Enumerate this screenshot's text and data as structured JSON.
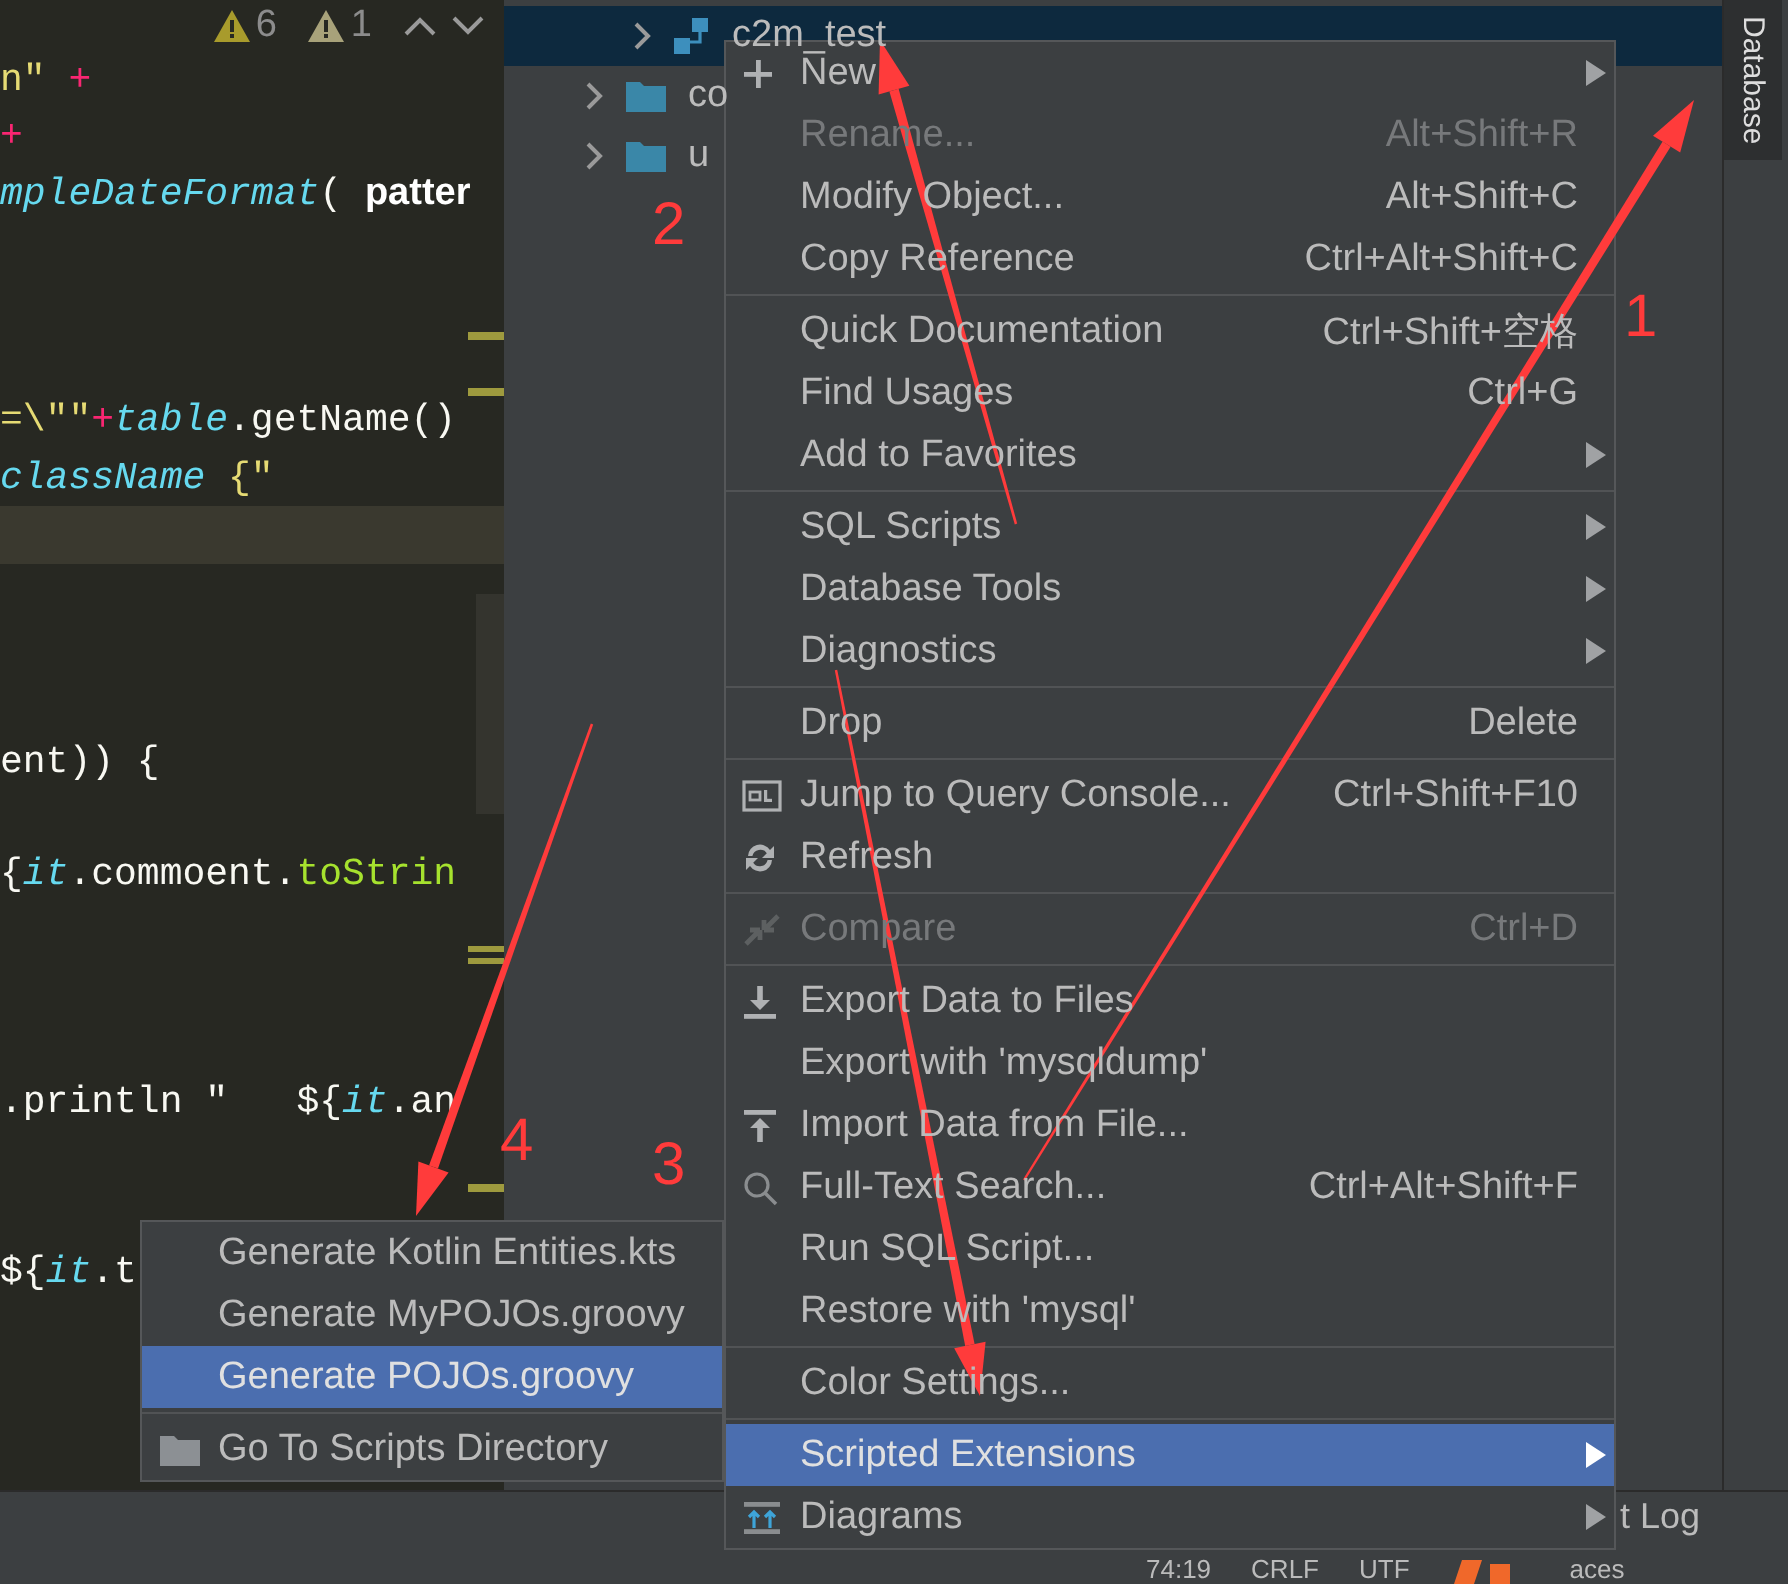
{
  "editor": {
    "warnings": [
      {
        "kind": "warning",
        "count": "6"
      },
      {
        "kind": "weak_warning",
        "count": "1"
      }
    ],
    "lines": [
      {
        "kind": "code",
        "segments": [
          {
            "kind": "string",
            "t": "n\""
          },
          {
            "kind": "op",
            "t": " +"
          }
        ]
      },
      {
        "kind": "code",
        "segments": [
          {
            "kind": "op",
            "t": "+"
          }
        ]
      },
      {
        "kind": "code",
        "segments": [
          {
            "kind": "type",
            "t": "mpleDateFormat"
          },
          {
            "kind": "plain",
            "t": "( "
          },
          {
            "kind": "hint",
            "t": "patter"
          }
        ]
      },
      {
        "kind": "blank"
      },
      {
        "kind": "marked"
      },
      {
        "kind": "marked"
      },
      {
        "kind": "code",
        "segments": [
          {
            "kind": "string",
            "t": "=\\\"\""
          },
          {
            "kind": "op",
            "t": "+"
          },
          {
            "kind": "type",
            "t": "table"
          },
          {
            "kind": "plain",
            "t": ".getName()"
          }
        ]
      },
      {
        "kind": "code",
        "segments": [
          {
            "kind": "type",
            "t": "className"
          },
          {
            "kind": "string",
            "t": " {\""
          }
        ]
      },
      {
        "kind": "current"
      },
      {
        "kind": "blank"
      },
      {
        "kind": "blank"
      },
      {
        "kind": "blank"
      },
      {
        "kind": "code",
        "segments": [
          {
            "kind": "plain",
            "t": "ent)) {"
          }
        ]
      },
      {
        "kind": "blank"
      },
      {
        "kind": "code",
        "segments": [
          {
            "kind": "plain",
            "t": "{"
          },
          {
            "kind": "type",
            "t": "it"
          },
          {
            "kind": "plain",
            "t": ".commoent."
          },
          {
            "kind": "method",
            "t": "toStrin"
          }
        ]
      },
      {
        "kind": "double_marked"
      },
      {
        "kind": "blank"
      },
      {
        "kind": "blank"
      },
      {
        "kind": "code",
        "segments": [
          {
            "kind": "plain",
            "t": ".println \"   ${"
          },
          {
            "kind": "type",
            "t": "it"
          },
          {
            "kind": "plain",
            "t": ".an"
          }
        ]
      },
      {
        "kind": "marked"
      },
      {
        "kind": "blank"
      },
      {
        "kind": "code",
        "segments": [
          {
            "kind": "plain",
            "t": "${"
          },
          {
            "kind": "type",
            "t": "it"
          },
          {
            "kind": "plain",
            "t": ".t"
          }
        ]
      }
    ]
  },
  "tree": {
    "rows": [
      {
        "label": "c2m_test",
        "kind": "schema",
        "selected": true
      },
      {
        "label": "co",
        "kind": "folder",
        "selected": false
      },
      {
        "label": "u",
        "kind": "folder",
        "selected": false
      }
    ]
  },
  "side_tabs": [
    {
      "label": "Database",
      "selected": true
    }
  ],
  "context_menu": {
    "groups": [
      {
        "items": [
          {
            "label": "New",
            "kind": "plus",
            "submenu": true,
            "disabled": false,
            "selected": false
          },
          {
            "label": "Rename...",
            "shortcut": "Alt+Shift+R",
            "disabled": true,
            "selected": false
          },
          {
            "label": "Modify Object...",
            "shortcut": "Alt+Shift+C",
            "disabled": false,
            "selected": false
          },
          {
            "label": "Copy Reference",
            "shortcut": "Ctrl+Alt+Shift+C",
            "disabled": false,
            "selected": false
          }
        ]
      },
      {
        "items": [
          {
            "label": "Quick Documentation",
            "shortcut": "Ctrl+Shift+空格",
            "disabled": false,
            "selected": false
          },
          {
            "label": "Find Usages",
            "shortcut": "Ctrl+G",
            "disabled": false,
            "selected": false
          },
          {
            "label": "Add to Favorites",
            "submenu": true,
            "disabled": false,
            "selected": false
          }
        ]
      },
      {
        "items": [
          {
            "label": "SQL Scripts",
            "submenu": true,
            "disabled": false,
            "selected": false
          },
          {
            "label": "Database Tools",
            "submenu": true,
            "disabled": false,
            "selected": false
          },
          {
            "label": "Diagnostics",
            "submenu": true,
            "disabled": false,
            "selected": false
          }
        ]
      },
      {
        "items": [
          {
            "label": "Drop",
            "shortcut": "Delete",
            "disabled": false,
            "selected": false
          }
        ]
      },
      {
        "items": [
          {
            "label": "Jump to Query Console...",
            "kind": "console",
            "shortcut": "Ctrl+Shift+F10",
            "disabled": false,
            "selected": false
          },
          {
            "label": "Refresh",
            "kind": "refresh",
            "disabled": false,
            "selected": false
          }
        ]
      },
      {
        "items": [
          {
            "label": "Compare",
            "kind": "compare",
            "shortcut": "Ctrl+D",
            "disabled": true,
            "selected": false
          }
        ]
      },
      {
        "items": [
          {
            "label": "Export Data to Files",
            "kind": "download",
            "disabled": false,
            "selected": false
          },
          {
            "label": "Export with 'mysqldump'",
            "disabled": false,
            "selected": false
          },
          {
            "label": "Import Data from File...",
            "kind": "upload",
            "disabled": false,
            "selected": false
          },
          {
            "label": "Full-Text Search...",
            "kind": "search",
            "shortcut": "Ctrl+Alt+Shift+F",
            "disabled": false,
            "selected": false
          },
          {
            "label": "Run SQL Script...",
            "disabled": false,
            "selected": false
          },
          {
            "label": "Restore with 'mysql'",
            "disabled": false,
            "selected": false
          }
        ]
      },
      {
        "items": [
          {
            "label": "Color Settings...",
            "disabled": false,
            "selected": false
          }
        ]
      },
      {
        "items": [
          {
            "label": "Scripted Extensions",
            "submenu": true,
            "disabled": false,
            "selected": true
          },
          {
            "label": "Diagrams",
            "kind": "diagram",
            "submenu": true,
            "disabled": false,
            "selected": false
          }
        ]
      }
    ]
  },
  "submenu": {
    "groups": [
      {
        "items": [
          {
            "label": "Generate Kotlin Entities.kts",
            "selected": false
          },
          {
            "label": "Generate MyPOJOs.groovy",
            "selected": false
          },
          {
            "label": "Generate POJOs.groovy",
            "selected": true
          }
        ]
      },
      {
        "items": [
          {
            "label": "Go To Scripts Directory",
            "kind": "folder",
            "selected": false
          }
        ]
      }
    ]
  },
  "tool_bar": {
    "items": [
      "t Log"
    ]
  },
  "status_bar": {
    "position": "74:19",
    "line_separator": "CRLF",
    "encoding": "UTF",
    "indent": "aces"
  },
  "annotations": [
    {
      "label": "1"
    },
    {
      "label": "2"
    },
    {
      "label": "3"
    },
    {
      "label": "4"
    }
  ]
}
